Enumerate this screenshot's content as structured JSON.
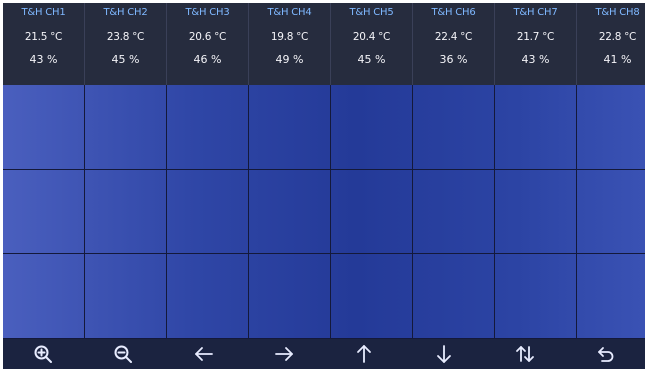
{
  "channels": [
    {
      "name": "T&H CH1",
      "temp": "21.5 °C",
      "humidity": "43 %"
    },
    {
      "name": "T&H CH2",
      "temp": "23.8 °C",
      "humidity": "45 %"
    },
    {
      "name": "T&H CH3",
      "temp": "20.6 °C",
      "humidity": "46 %"
    },
    {
      "name": "T&H CH4",
      "temp": "19.8 °C",
      "humidity": "49 %"
    },
    {
      "name": "T&H CH5",
      "temp": "20.4 °C",
      "humidity": "45 %"
    },
    {
      "name": "T&H CH6",
      "temp": "22.4 °C",
      "humidity": "36 %"
    },
    {
      "name": "T&H CH7",
      "temp": "21.7 °C",
      "humidity": "43 %"
    },
    {
      "name": "T&H CH8",
      "temp": "22.8 °C",
      "humidity": "41 %"
    }
  ],
  "toolbar": {
    "icons": [
      "zoom-in-icon",
      "zoom-out-icon",
      "arrow-left-icon",
      "arrow-right-icon",
      "arrow-up-icon",
      "arrow-down-icon",
      "swap-vertical-icon",
      "return-icon"
    ]
  },
  "colors": {
    "header_bg": "#262c3e",
    "channel_label": "#7fb8ff",
    "plot_bg": "#2f46a6",
    "toolbar_bg": "#1b2340",
    "icon_color": "#e8ecff"
  }
}
